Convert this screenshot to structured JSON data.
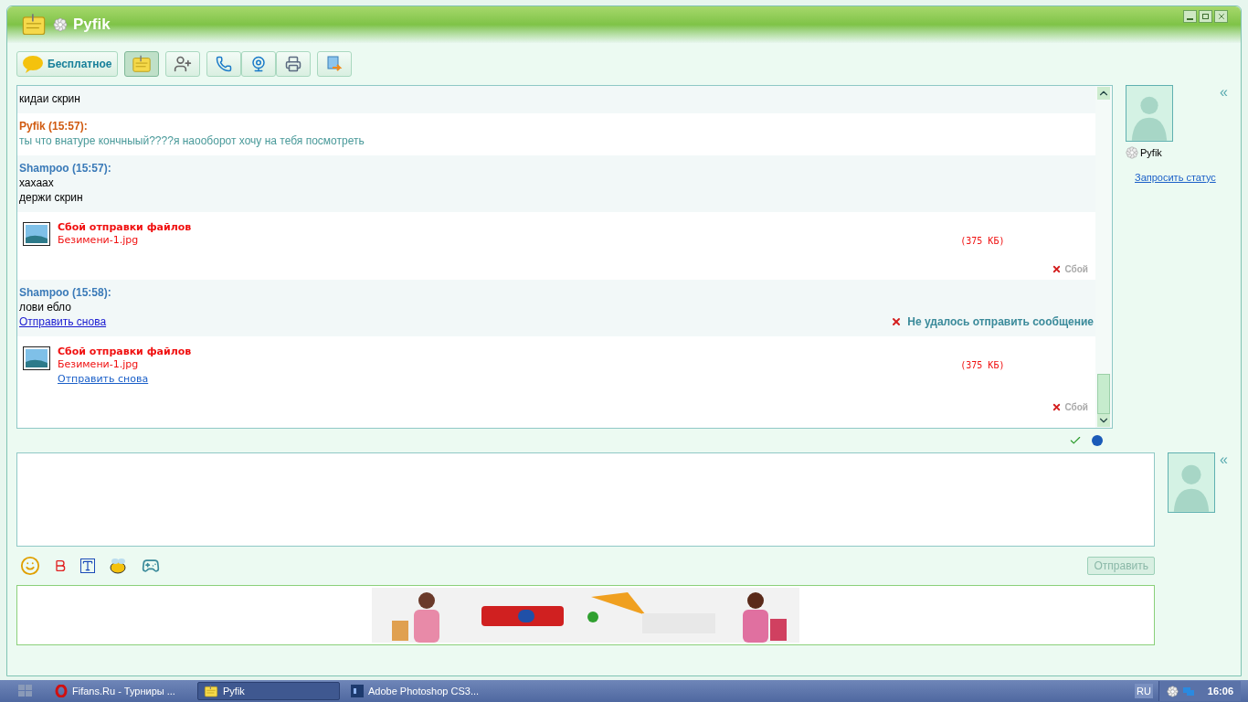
{
  "window": {
    "title": "Pyfik"
  },
  "toolbar": {
    "sms_button": "Бесплатное",
    "tools": [
      {
        "kind": "notes",
        "selected": true
      },
      {
        "kind": "add-contact",
        "selected": false
      }
    ]
  },
  "messages": [
    {
      "kind": "incoming",
      "lines": [
        "кидаи скрин"
      ]
    },
    {
      "kind": "outgoing",
      "author": "Pyfik (15:57):",
      "lines": [
        "ты что внатуре кончныый????я наооборот хочу на тебя посмотреть"
      ]
    },
    {
      "kind": "incoming",
      "author": "Shampoo (15:57):",
      "lines": [
        "хахаах",
        "держи скрин"
      ]
    },
    {
      "kind": "file",
      "title": "Сбой отправки файлов",
      "filename": "Безимени-1.jpg",
      "size": "(375 КБ)",
      "status": "Сбой"
    },
    {
      "kind": "incoming",
      "author": "Shampoo (15:58):",
      "lines": [
        "лови ебло"
      ],
      "retry": "Отправить снова",
      "error": "Не удалось отправить сообщение"
    },
    {
      "kind": "file",
      "title": "Сбой отправки файлов",
      "filename": "Безимени-1.jpg",
      "size": "(375 КБ)",
      "retry": "Отправить снова",
      "status": "Сбой"
    }
  ],
  "contact": {
    "name": "Pyfik",
    "request_status": "Запросить статус",
    "collapse": "«"
  },
  "input": {
    "send_button": "Отправить",
    "send_disabled": true,
    "collapse": "«"
  },
  "taskbar": {
    "tasks": [
      {
        "label": "Fifans.Ru - Турниры ...",
        "kind": "opera",
        "selected": false
      },
      {
        "label": "Pyfik",
        "kind": "note",
        "selected": true
      },
      {
        "label": "Adobe Photoshop CS3...",
        "kind": "ps",
        "selected": false
      }
    ],
    "language": "RU",
    "clock": "16:06"
  }
}
